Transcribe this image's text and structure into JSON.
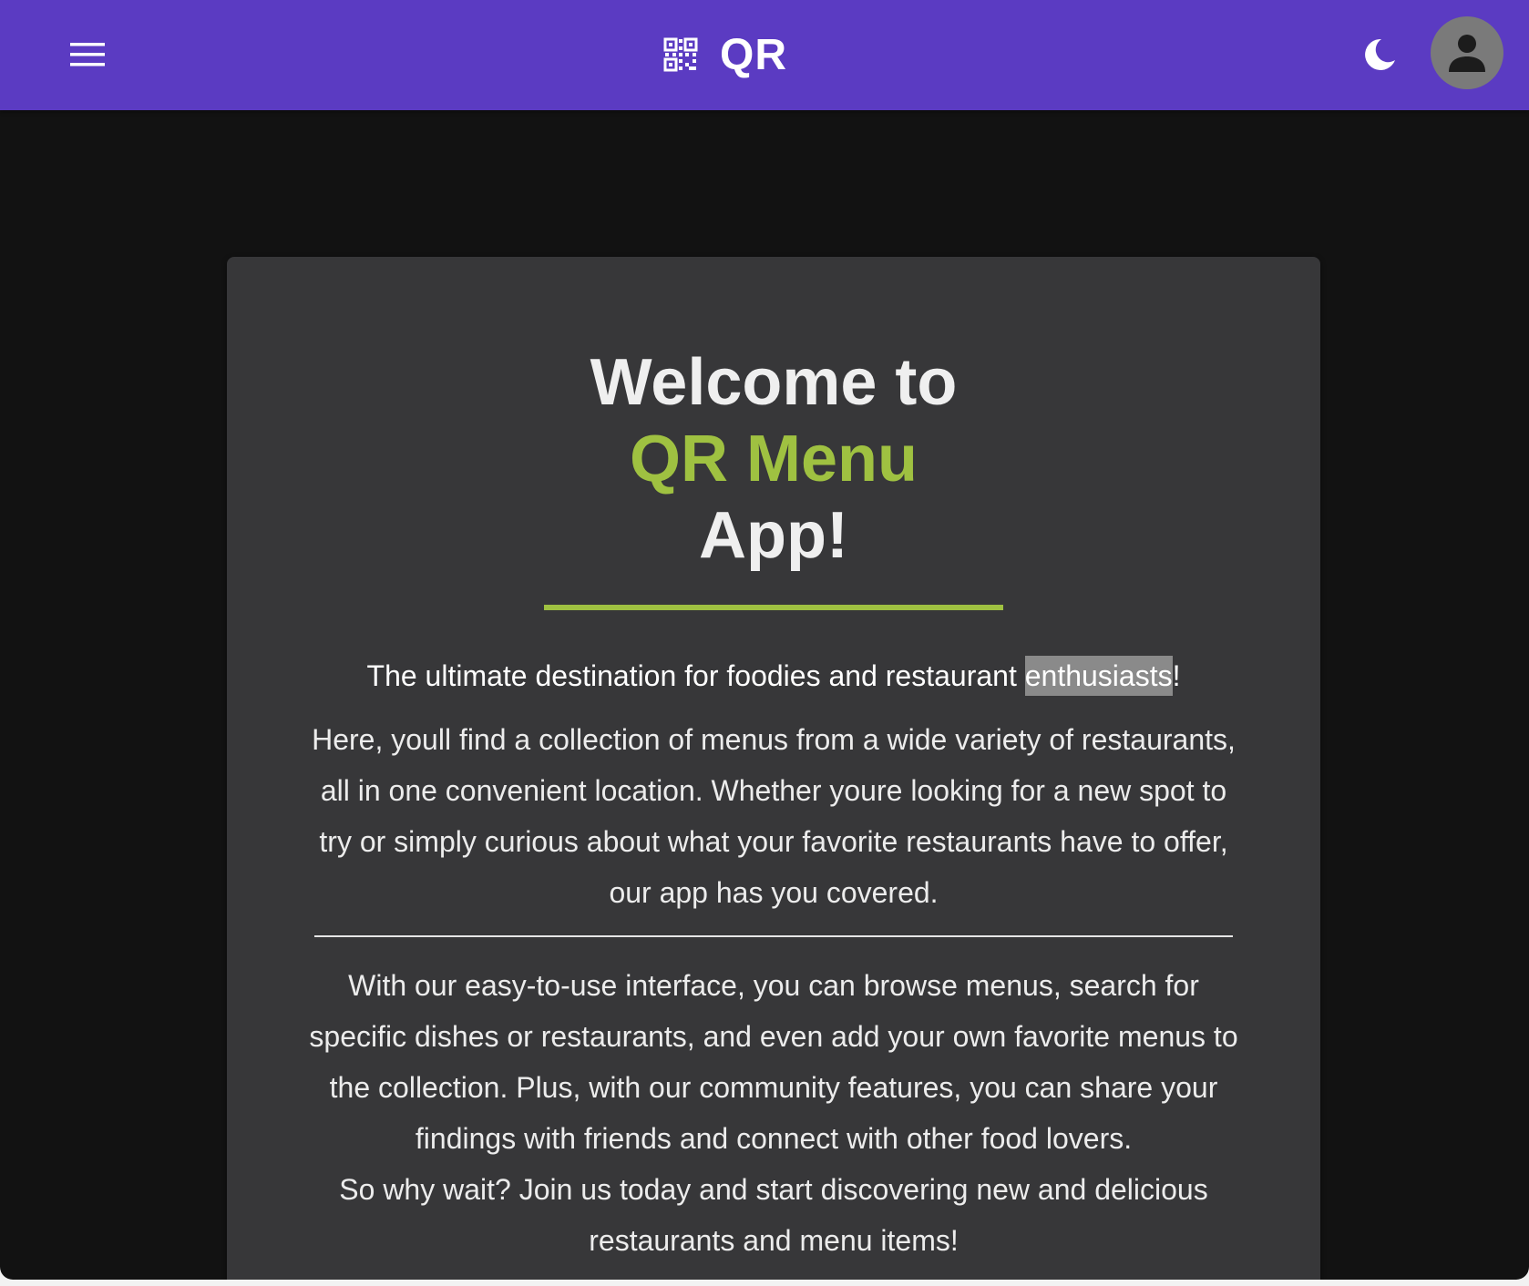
{
  "appbar": {
    "title": "QR",
    "menu_icon": "hamburger-menu-icon",
    "logo_icon": "qr-code-icon",
    "theme_icon": "moon-icon",
    "avatar_icon": "person-icon",
    "background": "#5b3bc2"
  },
  "hero": {
    "heading_line1": "Welcome to",
    "heading_line2": "QR Menu",
    "heading_line3": "App!",
    "accent_color": "#9fc141",
    "tagline_before": "The ultimate destination for foodies and restaurant ",
    "tagline_highlight": "enthusiasts",
    "tagline_after": "!",
    "paragraph1": "Here, youll find a collection of menus from a wide variety of restaurants, all in one convenient location. Whether youre looking for a new spot to try or simply curious about what your favorite restaurants have to offer, our app has you covered.",
    "paragraph2": "With our easy-to-use interface, you can browse menus, search for specific dishes or restaurants, and even add your own favorite menus to the collection. Plus, with our community features, you can share your findings with friends and connect with other food lovers.",
    "paragraph3": "So why wait? Join us today and start discovering new and delicious restaurants and menu items!"
  }
}
